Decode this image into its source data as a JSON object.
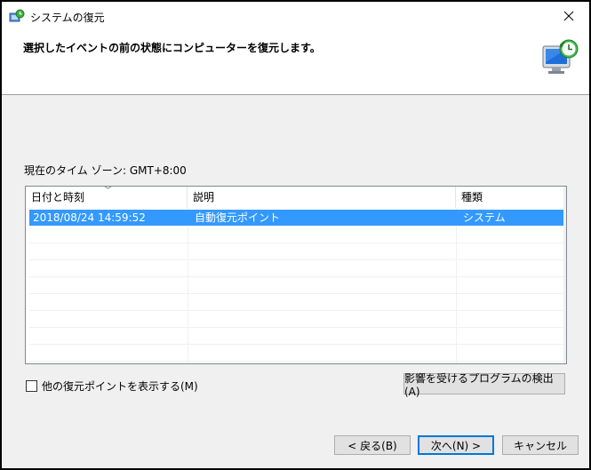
{
  "window": {
    "title": "システムの復元"
  },
  "header": {
    "instruction": "選択したイベントの前の状態にコンピューターを復元します。"
  },
  "timezone_label": "現在のタイム ゾーン: GMT+8:00",
  "table": {
    "columns": [
      "日付と時刻",
      "説明",
      "種類"
    ],
    "rows": [
      {
        "date": "2018/08/24 14:59:52",
        "description": "自動復元ポイント",
        "type": "システム",
        "selected": true
      }
    ]
  },
  "checkbox": {
    "label": "他の復元ポイントを表示する(M)",
    "checked": false
  },
  "buttons": {
    "scan_affected": "影響を受けるプログラムの検出(A)",
    "back": "< 戻る(B)",
    "next": "次へ(N) >",
    "cancel": "キャンセル"
  },
  "colors": {
    "selection": "#3399ff",
    "primary_border": "#0078d7"
  }
}
